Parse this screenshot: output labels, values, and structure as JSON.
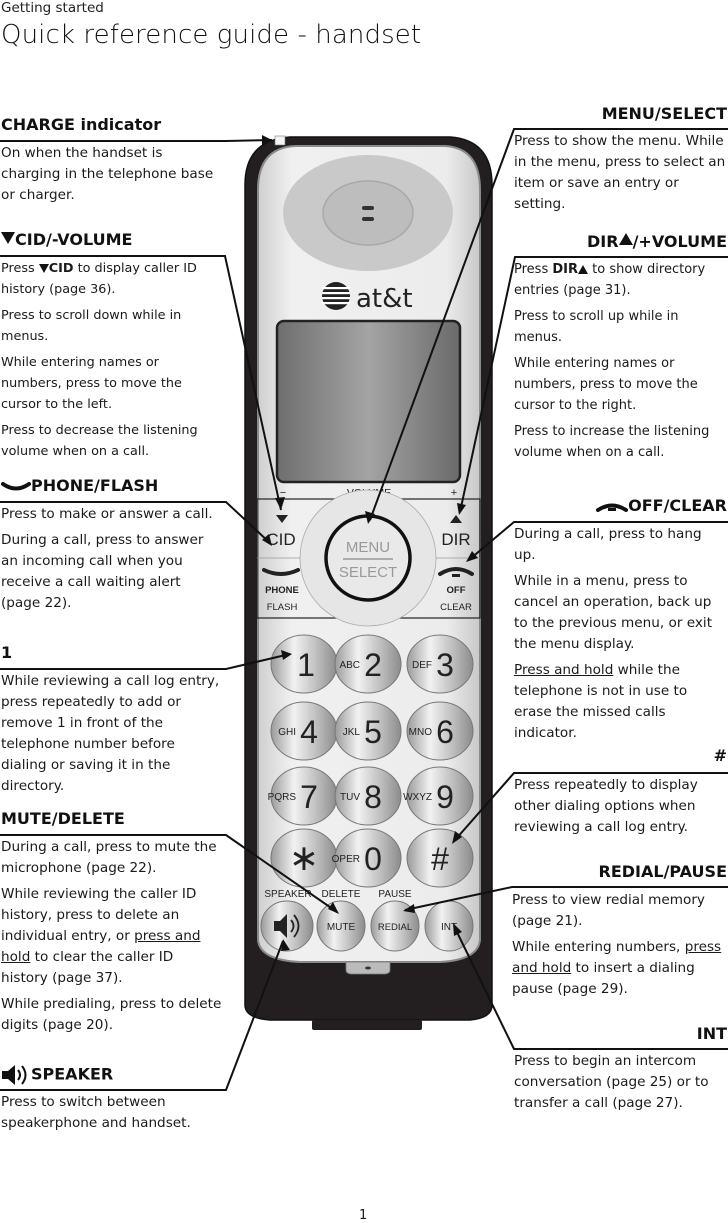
{
  "header": {
    "section": "Getting started",
    "title": "Quick reference guide - handset"
  },
  "left": {
    "charge": {
      "title": "CHARGE indicator",
      "p1": "On when the handset is charging in the telephone base or charger."
    },
    "cid": {
      "title": "CID/-VOLUME",
      "p1_pre": "Press ",
      "p1_key": "CID",
      "p1_post": " to display caller ID history (page 36).",
      "p2": "Press to scroll down while in menus.",
      "p3": "While entering names or numbers, press to move the cursor to the left.",
      "p4": "Press to decrease the listening volume when on a call."
    },
    "phone": {
      "title": "PHONE/FLASH",
      "p1": "Press to make or answer a call.",
      "p2": "During a call, press to answer an incoming call when you receive a call waiting alert (page 22)."
    },
    "one": {
      "title": "1",
      "p1": "While reviewing a call log entry, press repeatedly to add or remove 1 in front of the telephone number before dialing or saving it in the directory."
    },
    "mute": {
      "title": "MUTE/DELETE",
      "p1": "During a call, press to mute the microphone (page 22).",
      "p2_pre": "While reviewing the caller ID history, press to delete an individual entry, or ",
      "p2_u": "press and hold",
      "p2_post": " to clear the caller ID history (page 37).",
      "p3": "While predialing, press to delete digits (page 20)."
    },
    "speaker": {
      "title": "SPEAKER",
      "p1": "Press to switch between speakerphone and handset."
    }
  },
  "right": {
    "menu": {
      "title": "MENU/SELECT",
      "p1": "Press to show the menu. While in the menu, press to select an item or save an entry or setting."
    },
    "dir": {
      "title_a": "DIR",
      "title_b": "/+VOLUME",
      "p1_pre": "Press ",
      "p1_key": "DIR",
      "p1_post": " to show directory entries (page 31).",
      "p2": "Press to scroll up while in menus.",
      "p3": "While entering names or numbers, press to move the cursor to the right.",
      "p4": "Press to increase the listening volume when on a call."
    },
    "off": {
      "title": "OFF/CLEAR",
      "p1": "During a call, press to hang up.",
      "p2": "While in a menu, press to cancel an operation, back up to the previous menu, or exit the menu display.",
      "p3_u": "Press and hold",
      "p3_post": " while the telephone is not in use to erase the missed calls indicator."
    },
    "pound": {
      "title": "#",
      "p1": "Press repeatedly to display other dialing options when reviewing a call log entry."
    },
    "redial": {
      "title": "REDIAL/PAUSE",
      "p1": "Press to view redial memory (page 21).",
      "p2_pre": "While entering numbers, ",
      "p2_u": "press and hold",
      "p2_post": " to insert a dialing pause (page 29)."
    },
    "int": {
      "title": "INT",
      "p1": "Press to begin an intercom conversation (page 25) or to transfer a call (page 27)."
    }
  },
  "handset": {
    "brand": "at&t",
    "volume_label": "VOLUME",
    "volume_minus": "−",
    "volume_plus": "+",
    "cid": "CID",
    "dir": "DIR",
    "menu": "MENU",
    "select": "SELECT",
    "phone": "PHONE",
    "flash": "FLASH",
    "off": "OFF",
    "clear": "CLEAR",
    "keys": [
      {
        "digit": "1",
        "letters": ""
      },
      {
        "digit": "2",
        "letters": "ABC"
      },
      {
        "digit": "3",
        "letters": "DEF"
      },
      {
        "digit": "4",
        "letters": "GHI"
      },
      {
        "digit": "5",
        "letters": "JKL"
      },
      {
        "digit": "6",
        "letters": "MNO"
      },
      {
        "digit": "7",
        "letters": "PQRS"
      },
      {
        "digit": "8",
        "letters": "TUV"
      },
      {
        "digit": "9",
        "letters": "WXYZ"
      },
      {
        "digit": "*",
        "letters": ""
      },
      {
        "digit": "0",
        "letters": "OPER"
      },
      {
        "digit": "#",
        "letters": ""
      }
    ],
    "speaker_label": "SPEAKER",
    "delete_label": "DELETE",
    "pause_label": "PAUSE",
    "mute": "MUTE",
    "redial": "REDIAL",
    "int": "INT"
  },
  "footer": {
    "page": "1"
  }
}
